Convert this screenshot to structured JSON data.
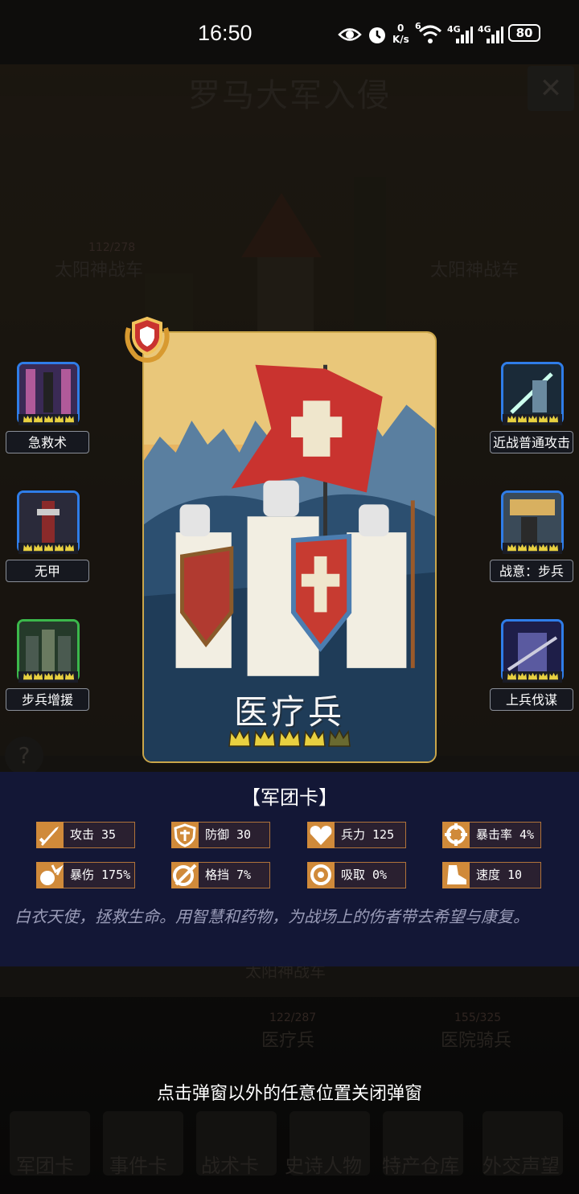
{
  "status_bar": {
    "time": "16:50",
    "net_speed_top": "0",
    "net_speed_bottom": "K/s",
    "sim1": "4G",
    "sim2": "4G",
    "wifi_badge": "6",
    "battery": "80"
  },
  "background": {
    "title": "罗马大军入侵",
    "left_army": "太阳神战车",
    "left_hp": "112/278",
    "right_army": "太阳神战车",
    "mid_army": "太阳神战车",
    "unit1_name": "医疗兵",
    "unit1_hp": "122/287",
    "unit2_name": "医院骑兵",
    "unit2_hp": "155/325",
    "tabs": [
      "军团卡",
      "事件卡",
      "战术卡",
      "史诗人物",
      "特产仓库",
      "外交声望"
    ]
  },
  "card": {
    "name": "医疗兵",
    "stars": 4,
    "max_stars": 5
  },
  "skills_left": [
    {
      "label": "急救术",
      "frame": "blue"
    },
    {
      "label": "无甲",
      "frame": "blue"
    },
    {
      "label": "步兵增援",
      "frame": "green"
    }
  ],
  "skills_right": [
    {
      "label": "近战普通攻击",
      "frame": "blue"
    },
    {
      "label": "战意：步兵",
      "frame": "blue"
    },
    {
      "label": "上兵伐谋",
      "frame": "blue"
    }
  ],
  "panel": {
    "title": "【军团卡】",
    "stats": [
      {
        "icon": "sword-icon",
        "text": "攻击 35"
      },
      {
        "icon": "shield-icon",
        "text": "防御 30"
      },
      {
        "icon": "heart-icon",
        "text": "兵力 125"
      },
      {
        "icon": "crosshair-icon",
        "text": "暴击率 4%"
      },
      {
        "icon": "burst-icon",
        "text": "暴伤 175%"
      },
      {
        "icon": "parry-icon",
        "text": "格挡 7%"
      },
      {
        "icon": "drain-icon",
        "text": "吸取 0%"
      },
      {
        "icon": "boot-icon",
        "text": "速度 10"
      }
    ],
    "description": "白衣天使，拯救生命。用智慧和药物，为战场上的伤者带去希望与康复。"
  },
  "hint": "点击弹窗以外的任意位置关闭弹窗",
  "colors": {
    "panel_bg": "#141838",
    "stat_icon": "#d08a3a",
    "skill_blue": "#2f7de8",
    "skill_green": "#3bb84b",
    "crown": "#e8d040"
  }
}
